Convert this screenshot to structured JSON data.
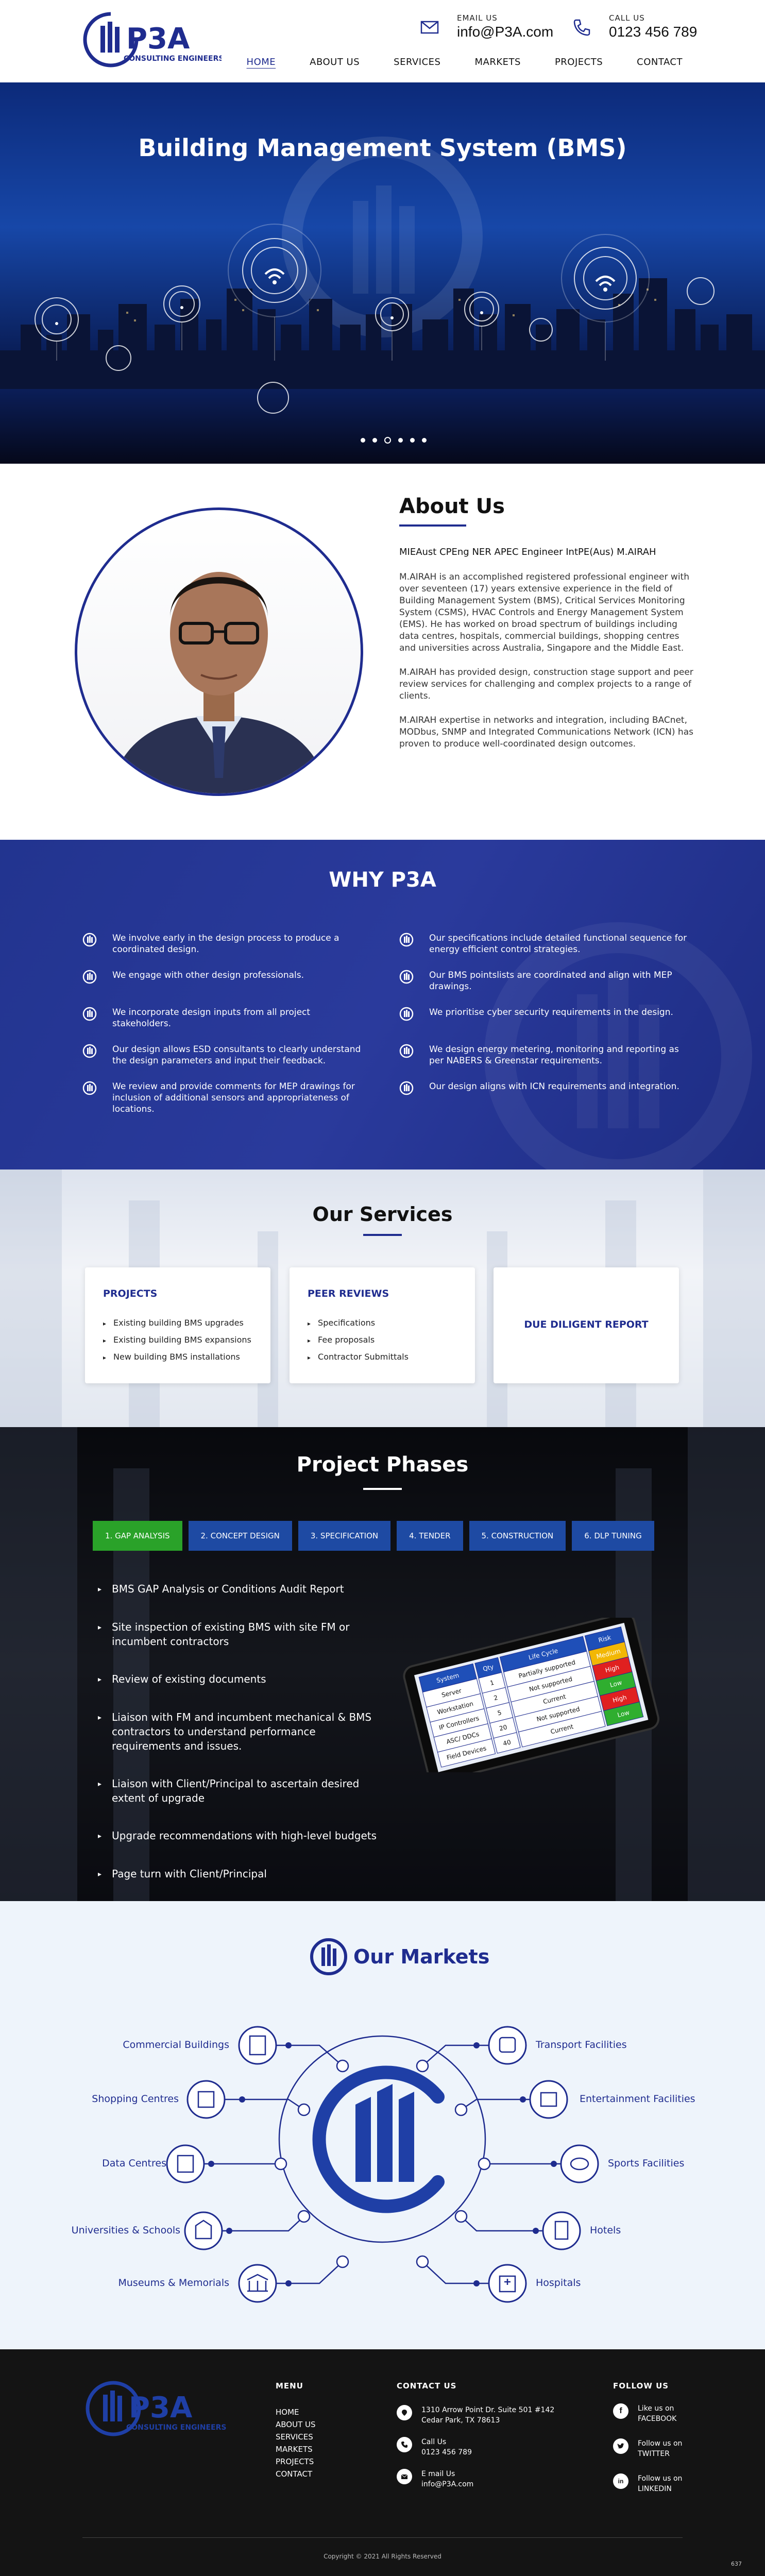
{
  "header": {
    "logo_text": "P3A",
    "logo_tagline": "CONSULTING ENGINEERS",
    "email_label": "EMAIL US",
    "email_value": "info@P3A.com",
    "call_label": "CALL US",
    "call_value": "0123 456 789",
    "nav": [
      {
        "label": "HOME",
        "active": true
      },
      {
        "label": "ABOUT US"
      },
      {
        "label": "SERVICES"
      },
      {
        "label": "MARKETS"
      },
      {
        "label": "PROJECTS"
      },
      {
        "label": "CONTACT"
      }
    ]
  },
  "hero": {
    "title": "Building Management System (BMS)",
    "slides": 6,
    "current_slide": 3
  },
  "about": {
    "title": "About Us",
    "credentials": "MIEAust CPEng NER APEC Engineer IntPE(Aus) M.AIRAH",
    "paragraphs": [
      "M.AIRAH is an accomplished registered professional engineer with over seventeen (17) years extensive experience in the field of Building Management System (BMS), Critical Services Monitoring System (CSMS), HVAC Controls and Energy Management System (EMS). He has worked on broad spectrum of buildings including data centres, hospitals, commercial buildings, shopping centres and universities across Australia, Singapore and the Middle East.",
      "M.AIRAH has provided design, construction stage support and peer review services for challenging and complex projects to a range of clients.",
      "M.AIRAH expertise in networks and integration, including BACnet, MODbus, SNMP and Integrated Communications Network (ICN) has proven to produce well-coordinated design outcomes."
    ]
  },
  "why": {
    "title": "WHY P3A",
    "left": [
      "We involve early in the design process to produce a coordinated design.",
      "We engage with other design professionals.",
      "We incorporate design inputs from all project stakeholders.",
      "Our design allows ESD consultants to clearly understand the design parameters and input their feedback.",
      "We review and provide comments for MEP drawings for inclusion of additional sensors and appropriateness of locations."
    ],
    "right": [
      "Our specifications include detailed functional sequence for energy efficient control strategies.",
      "Our BMS pointslists are coordinated and align with MEP drawings.",
      "We prioritise cyber security requirements in the design.",
      "We design energy metering, monitoring and reporting as per NABERS & Greenstar requirements.",
      "Our design aligns with ICN requirements and integration."
    ]
  },
  "services": {
    "title": "Our Services",
    "cards": [
      {
        "title": "PROJECTS",
        "items": [
          "Existing building BMS upgrades",
          "Existing building BMS expansions",
          "New building BMS installations"
        ]
      },
      {
        "title": "PEER REVIEWS",
        "items": [
          "Specifications",
          "Fee proposals",
          "Contractor Submittals"
        ]
      },
      {
        "title": "DUE DILIGENT REPORT",
        "items": []
      }
    ]
  },
  "phases": {
    "title": "Project Phases",
    "tabs": [
      "1. GAP ANALYSIS",
      "2. CONCEPT DESIGN",
      "3. SPECIFICATION",
      "4. TENDER",
      "5. CONSTRUCTION",
      "6. DLP TUNING"
    ],
    "active_tab": 0,
    "items": [
      "BMS GAP Analysis or Conditions Audit Report",
      "Site inspection of existing BMS with site FM or incumbent contractors",
      "Review of existing documents",
      "Liaison with FM and incumbent mechanical & BMS contractors to understand performance requirements and issues.",
      "Liaison with Client/Principal  to ascertain desired extent of upgrade",
      "Upgrade recommendations with high-level budgets",
      "Page turn with Client/Principal"
    ],
    "tablet_table": {
      "headers": [
        "System",
        "Qty",
        "Life Cycle",
        "Risk"
      ],
      "rows": [
        [
          "Server",
          "1",
          "Partially supported",
          "Medium"
        ],
        [
          "Workstation",
          "2",
          "Not supported",
          "High"
        ],
        [
          "IP Controllers",
          "5",
          "Current",
          "Low"
        ],
        [
          "ASC/ DDCs",
          "20",
          "Not supported",
          "High"
        ],
        [
          "Field Devices",
          "40",
          "Current",
          "Low"
        ]
      ],
      "risk_colors": {
        "Medium": "#f2b705",
        "High": "#e02020",
        "Low": "#2fae2f"
      }
    }
  },
  "markets": {
    "title": "Our Markets",
    "left": [
      "Commercial Buildings",
      "Shopping Centres",
      "Data Centres",
      "Universities & Schools",
      "Museums & Memorials"
    ],
    "right": [
      "Transport Facilities",
      "Entertainment Facilities",
      "Sports Facilities",
      "Hotels",
      "Hospitals"
    ],
    "left_icons": [
      "office-building-icon",
      "shopping-store-icon",
      "server-rack-icon",
      "school-icon",
      "museum-icon"
    ],
    "right_icons": [
      "bus-icon",
      "theatre-icon",
      "stadium-icon",
      "hotel-icon",
      "hospital-icon"
    ]
  },
  "footer": {
    "menu_title": "MENU",
    "menu": [
      "HOME",
      "ABOUT US",
      "SERVICES",
      "MARKETS",
      "PROJECTS",
      "CONTACT"
    ],
    "contact_title": "CONTACT US",
    "address_line1": "1310 Arrow Point Dr. Suite 501 #142",
    "address_line2": "Cedar Park, TX 78613",
    "call_label": "Call Us",
    "call_value": "0123 456 789",
    "email_label": "E mail Us",
    "email_value": "info@P3A.com",
    "follow_title": "FOLLOW US",
    "social": [
      {
        "line1": "Like us on",
        "line2": "FACEBOOK",
        "icon": "facebook-icon"
      },
      {
        "line1": "Follow us on",
        "line2": "TWITTER",
        "icon": "twitter-icon"
      },
      {
        "line1": "Follow us on",
        "line2": "LINKEDIN",
        "icon": "linkedin-icon"
      }
    ],
    "copyright": "Copyright © 2021 All Rights Reserved",
    "page_number": "637"
  },
  "colors": {
    "brand_blue": "#1f2c8f",
    "tab_blue": "#1e4aa3",
    "tab_active": "#2aa229",
    "footer_bg": "#141414"
  }
}
